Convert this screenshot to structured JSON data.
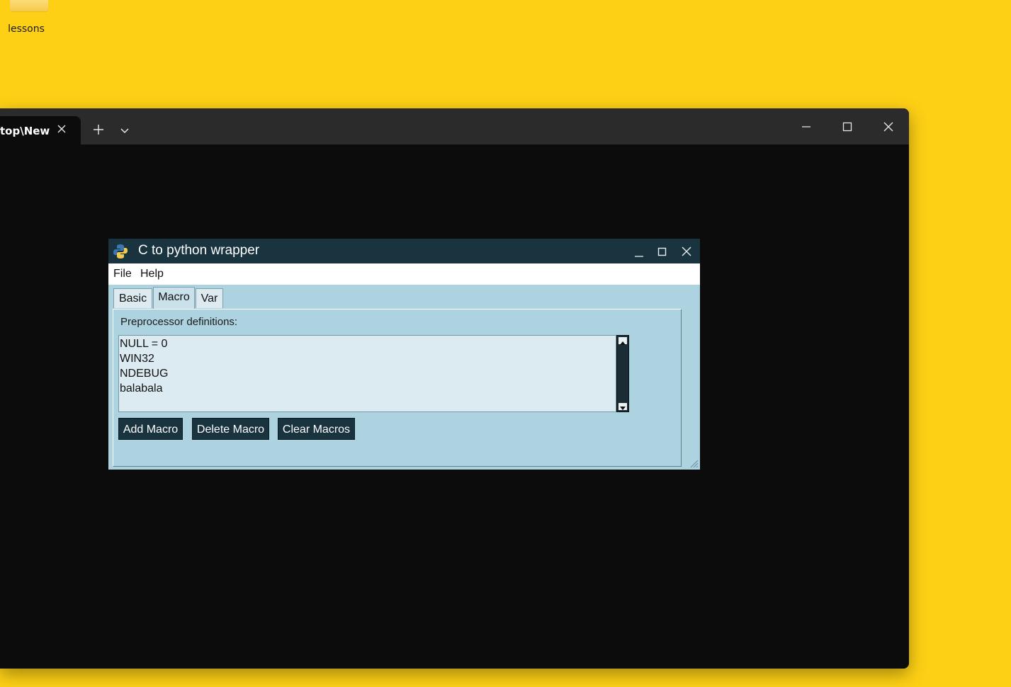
{
  "desktop": {
    "icon_label": "lessons"
  },
  "terminal": {
    "tab_title": "top\\New",
    "colors": {
      "tabbar": "#2B2B2B",
      "body": "#0C0C0C"
    }
  },
  "app": {
    "title": "C to python wrapper",
    "menu": [
      "File",
      "Help"
    ],
    "tabs": [
      {
        "label": "Basic"
      },
      {
        "label": "Macro",
        "selected": true
      },
      {
        "label": "Var"
      }
    ],
    "macro_panel": {
      "label": "Preprocessor definitions:",
      "macros": [
        "NULL = 0",
        "WIN32",
        "NDEBUG",
        "balabala"
      ],
      "buttons": {
        "add": "Add Macro",
        "delete": "Delete Macro",
        "clear": "Clear Macros"
      }
    },
    "colors": {
      "titlebar": "#19333F",
      "background": "#AED3E0",
      "button": "#19333F"
    }
  }
}
